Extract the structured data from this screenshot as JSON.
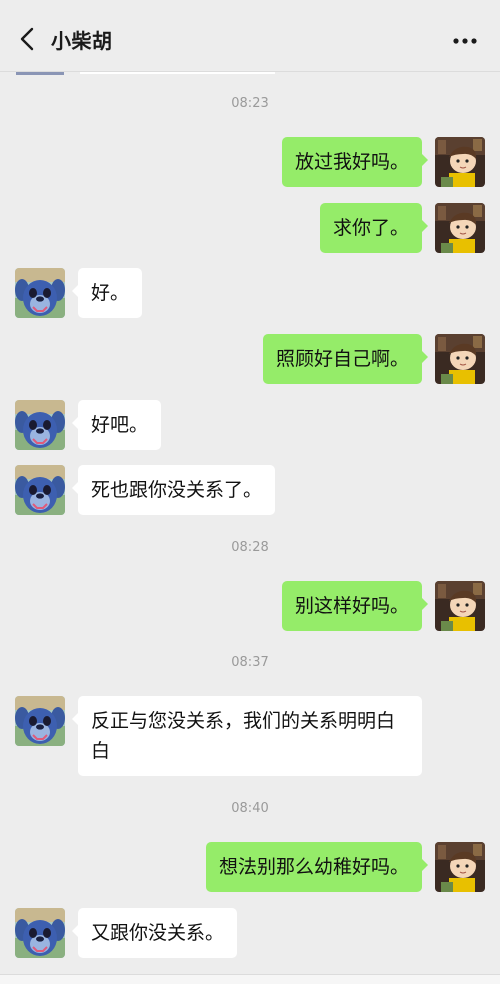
{
  "header": {
    "title": "小柴胡"
  },
  "icons": {
    "back": "chevron-left-icon",
    "more": "more-dots-icon"
  },
  "colors": {
    "background": "#ededed",
    "outgoing_bubble": "#95ec69",
    "incoming_bubble": "#ffffff",
    "timestamp_text": "#9a9a9a"
  },
  "chat": {
    "times": [
      "08:23",
      "08:28",
      "08:37",
      "08:40"
    ],
    "messages": [
      {
        "sender": "me",
        "text": "放过我好吗。"
      },
      {
        "sender": "me",
        "text": "求你了。"
      },
      {
        "sender": "contact",
        "text": "好。"
      },
      {
        "sender": "me",
        "text": "照顾好自己啊。"
      },
      {
        "sender": "contact",
        "text": "好吧。"
      },
      {
        "sender": "contact",
        "text": "死也跟你没关系了。"
      },
      {
        "sender": "me",
        "text": "别这样好吗。"
      },
      {
        "sender": "contact",
        "text": "反正与您没关系，我们的关系明明白白"
      },
      {
        "sender": "me",
        "text": "想法别那么幼稚好吗。"
      },
      {
        "sender": "contact",
        "text": "又跟你没关系。"
      }
    ]
  }
}
